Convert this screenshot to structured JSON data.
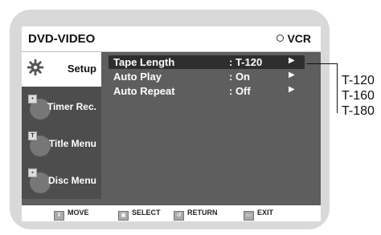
{
  "screen": {
    "mode_title": "DVD-VIDEO",
    "vcr_label": "VCR"
  },
  "sidebar": {
    "items": [
      {
        "label": "Setup",
        "icon": "gear-icon",
        "selected": true
      },
      {
        "label": "Timer Rec.",
        "icon": "timer-icon",
        "selected": false
      },
      {
        "label": "Title Menu",
        "icon": "title-icon",
        "selected": false
      },
      {
        "label": "Disc Menu",
        "icon": "disc-icon",
        "selected": false
      }
    ]
  },
  "menu": {
    "rows": [
      {
        "label": "Tape Length",
        "value": ": T-120",
        "arrow": "▶"
      },
      {
        "label": "Auto Play",
        "value": ": On",
        "arrow": "▶"
      },
      {
        "label": "Auto Repeat",
        "value": ": Off",
        "arrow": "▶"
      }
    ]
  },
  "bottombar": {
    "move": "MOVE",
    "select": "SELECT",
    "return": "RETURN",
    "exit": "EXIT"
  },
  "callout": {
    "options": [
      "T-120",
      "T-160",
      "T-180"
    ]
  }
}
